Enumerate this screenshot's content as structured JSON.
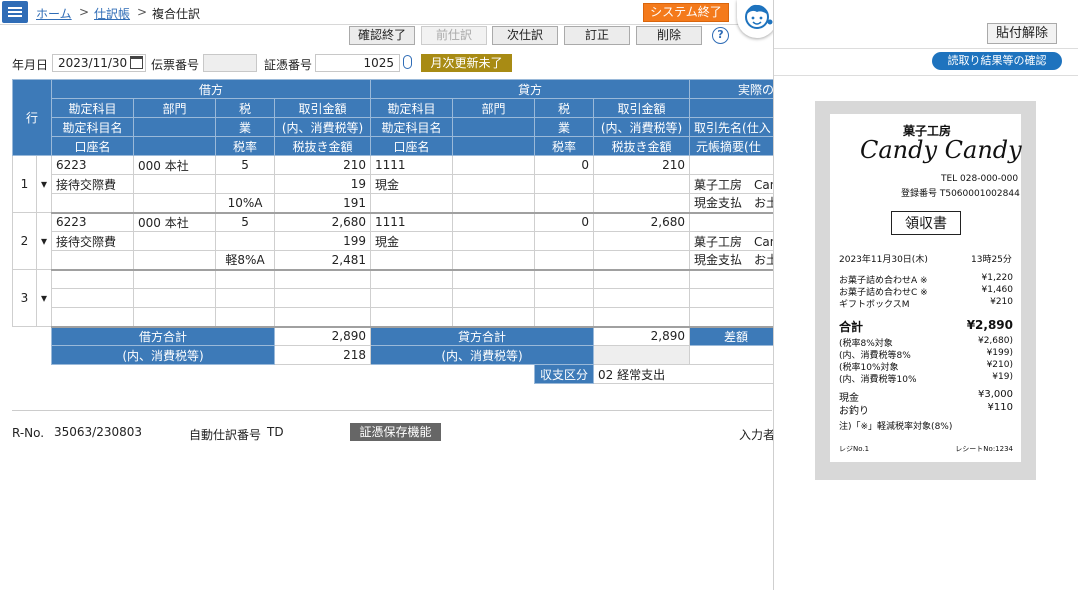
{
  "breadcrumb": {
    "home": "ホーム",
    "sep1": ">",
    "ledger": "仕訳帳",
    "sep2": ">",
    "current": "複合仕訳"
  },
  "header": {
    "system_end": "システム終了"
  },
  "toolbar": {
    "confirm_end": "確認終了",
    "prev": "前仕訳",
    "next": "次仕訳",
    "correct": "訂正",
    "delete": "削除",
    "help": "?"
  },
  "form": {
    "date_label": "年月日",
    "date_value": "2023/11/30",
    "slip_label": "伝票番号",
    "slip_value": "",
    "voucher_label": "証憑番号",
    "voucher_value": "1025",
    "monthly_status": "月次更新未了"
  },
  "grid": {
    "h_row": "行",
    "h_debit": "借方",
    "h_credit": "貸方",
    "h_account": "勘定科目",
    "h_dept": "部門",
    "h_tax": "税",
    "h_amount": "取引金額",
    "h_account_name": "勘定科目名",
    "h_business": "業",
    "h_incl_tax": "(内、消費税等)",
    "h_bank": "口座名",
    "h_rate": "税率",
    "h_excl": "税抜き金額",
    "h_actual": "実際の",
    "h_partner": "取引先名(仕入",
    "h_memo": "元帳摘要(仕",
    "rows": [
      {
        "no": "1",
        "mark": "▾",
        "d_code": "6223",
        "d_dept": "000 本社",
        "d_tax": "5",
        "d_amount": "210",
        "d_name": "接待交際費",
        "d_taxamt": "19",
        "d_rate": "10%A",
        "d_excl": "191",
        "c_code": "1111",
        "c_tax": "0",
        "c_amount": "210",
        "c_name": "現金",
        "partner": "菓子工房　Can",
        "memo": "現金支払　お土"
      },
      {
        "no": "2",
        "mark": "▾",
        "d_code": "6223",
        "d_dept": "000 本社",
        "d_tax": "5",
        "d_amount": "2,680",
        "d_name": "接待交際費",
        "d_taxamt": "199",
        "d_rate": "軽8%A",
        "d_excl": "2,481",
        "c_code": "1111",
        "c_tax": "0",
        "c_amount": "2,680",
        "c_name": "現金",
        "partner": "菓子工房　Can",
        "memo": "現金支払　お土"
      },
      {
        "no": "3",
        "mark": "▾",
        "d_code": "",
        "d_dept": "",
        "d_tax": "",
        "d_amount": "",
        "d_name": "",
        "d_taxamt": "",
        "d_rate": "",
        "d_excl": "",
        "c_code": "",
        "c_tax": "",
        "c_amount": "",
        "c_name": "",
        "partner": "",
        "memo": ""
      }
    ],
    "debit_total_label": "借方合計",
    "debit_total": "2,890",
    "credit_total_label": "貸方合計",
    "credit_total": "2,890",
    "incl_tax_label": "(内、消費税等)",
    "debit_tax_total": "218",
    "diff_label": "差額",
    "income_label": "収支区分",
    "income_value": "02 経常支出"
  },
  "footer": {
    "rno_label": "R-No.",
    "rno_value": "35063/230803",
    "auto_label": "自動仕訳番号",
    "auto_value": "TD",
    "stamp_btn": "証憑保存機能",
    "input_label": "入力者"
  },
  "receipt_panel": {
    "detach": "貼付解除",
    "confirm": "読取り結果等の確認",
    "shop": "菓子工房",
    "brand": "Candy Candy",
    "tel": "TEL 028-000-000",
    "reg": "登録番号 T5060001002844",
    "title": "領収書",
    "date": "2023年11月30日(木)",
    "time": "13時25分",
    "items": [
      {
        "name": "お菓子詰め合わせA ※",
        "price": "¥1,220"
      },
      {
        "name": "お菓子詰め合わせC ※",
        "price": "¥1,460"
      },
      {
        "name": "ギフトボックスM",
        "price": "¥210"
      }
    ],
    "total_label": "合計",
    "total": "¥2,890",
    "breakdown": [
      {
        "name": "(税率8%対象",
        "price": "¥2,680)"
      },
      {
        "name": "(内、消費税等8%",
        "price": "¥199)"
      },
      {
        "name": "(税率10%対象",
        "price": "¥210)"
      },
      {
        "name": "(内、消費税等10%",
        "price": "¥19)"
      }
    ],
    "cash_label": "現金",
    "cash": "¥3,000",
    "change_label": "お釣り",
    "change": "¥110",
    "note": "注)「※」軽減税率対象(8%)",
    "register": "レジNo.1",
    "receipt_no": "レシートNo:1234"
  },
  "colors": {
    "header_blue": "#3d7ab8",
    "accent_orange": "#f47a1b",
    "status_gold": "#a88b14",
    "confirm_blue": "#1e73be"
  }
}
